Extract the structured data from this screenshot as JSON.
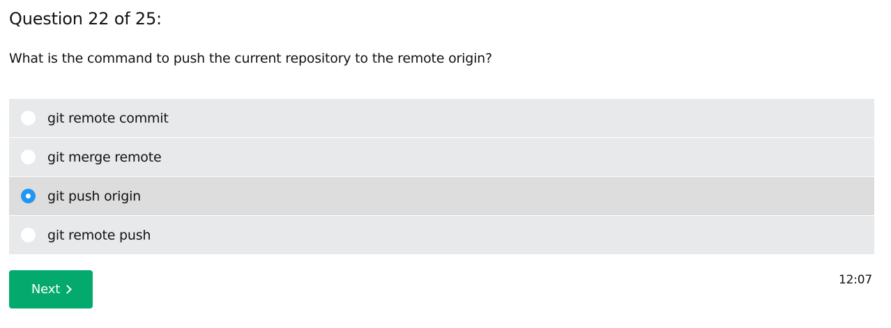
{
  "header": {
    "title": "Question 22 of 25:"
  },
  "question": {
    "text": "What is the command to push the current repository to the remote origin?"
  },
  "options": [
    {
      "label": "git remote commit",
      "selected": false
    },
    {
      "label": "git merge remote",
      "selected": false
    },
    {
      "label": "git push origin",
      "selected": true
    },
    {
      "label": "git remote push",
      "selected": false
    }
  ],
  "footer": {
    "next_label": "Next",
    "next_icon": "chevron-right-icon",
    "timer": "12:07"
  },
  "colors": {
    "option_bg": "#e8e9eb",
    "option_selected_bg": "#dddddd",
    "radio_selected": "#2196f3",
    "next_button_bg": "#04aa6d"
  }
}
